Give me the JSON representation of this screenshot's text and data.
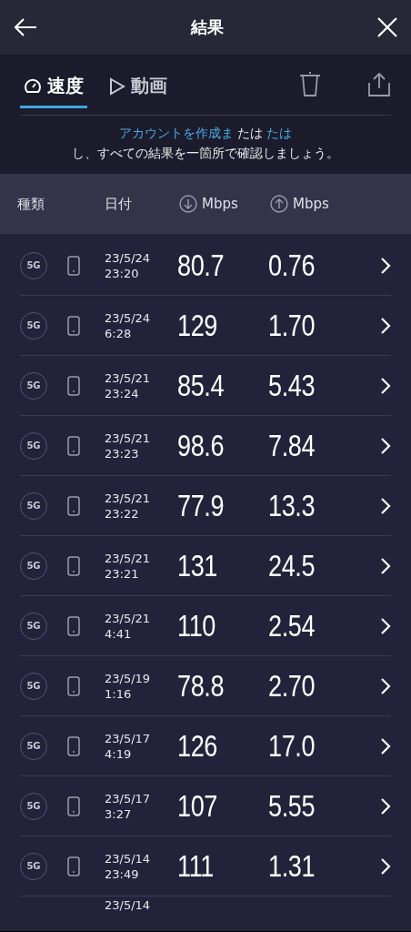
{
  "title": "結果",
  "tabs": [
    {
      "label": "速度",
      "selected": true
    },
    {
      "label": "動画",
      "selected": false
    }
  ],
  "banner": {
    "link": "アカウントを作成ま",
    "middle": "たは",
    "link2": "たは",
    "rest": "し、すべての結果を一箇所で確認しましょう。"
  },
  "columns": [
    "種類",
    "日付",
    "Mbps",
    "Mbps"
  ],
  "rows": [
    {
      "network": "5G",
      "date": "23/5/24",
      "time": "23:20",
      "download": "80.7",
      "upload": "0.76"
    },
    {
      "network": "5G",
      "date": "23/5/24",
      "time": "6:28",
      "download": "129",
      "upload": "1.70"
    },
    {
      "network": "5G",
      "date": "23/5/21",
      "time": "23:24",
      "download": "85.4",
      "upload": "5.43"
    },
    {
      "network": "5G",
      "date": "23/5/21",
      "time": "23:23",
      "download": "98.6",
      "upload": "7.84"
    },
    {
      "network": "5G",
      "date": "23/5/21",
      "time": "23:22",
      "download": "77.9",
      "upload": "13.3"
    },
    {
      "network": "5G",
      "date": "23/5/21",
      "time": "23:21",
      "download": "131",
      "upload": "24.5"
    },
    {
      "network": "5G",
      "date": "23/5/21",
      "time": "4:41",
      "download": "110",
      "upload": "2.54"
    },
    {
      "network": "5G",
      "date": "23/5/19",
      "time": "1:16",
      "download": "78.8",
      "upload": "2.70"
    },
    {
      "network": "5G",
      "date": "23/5/17",
      "time": "4:19",
      "download": "126",
      "upload": "17.0"
    },
    {
      "network": "5G",
      "date": "23/5/17",
      "time": "3:27",
      "download": "107",
      "upload": "5.55"
    },
    {
      "network": "5G",
      "date": "23/5/14",
      "time": "23:49",
      "download": "111",
      "upload": "1.31"
    },
    {
      "date": "23/5/14"
    }
  ]
}
